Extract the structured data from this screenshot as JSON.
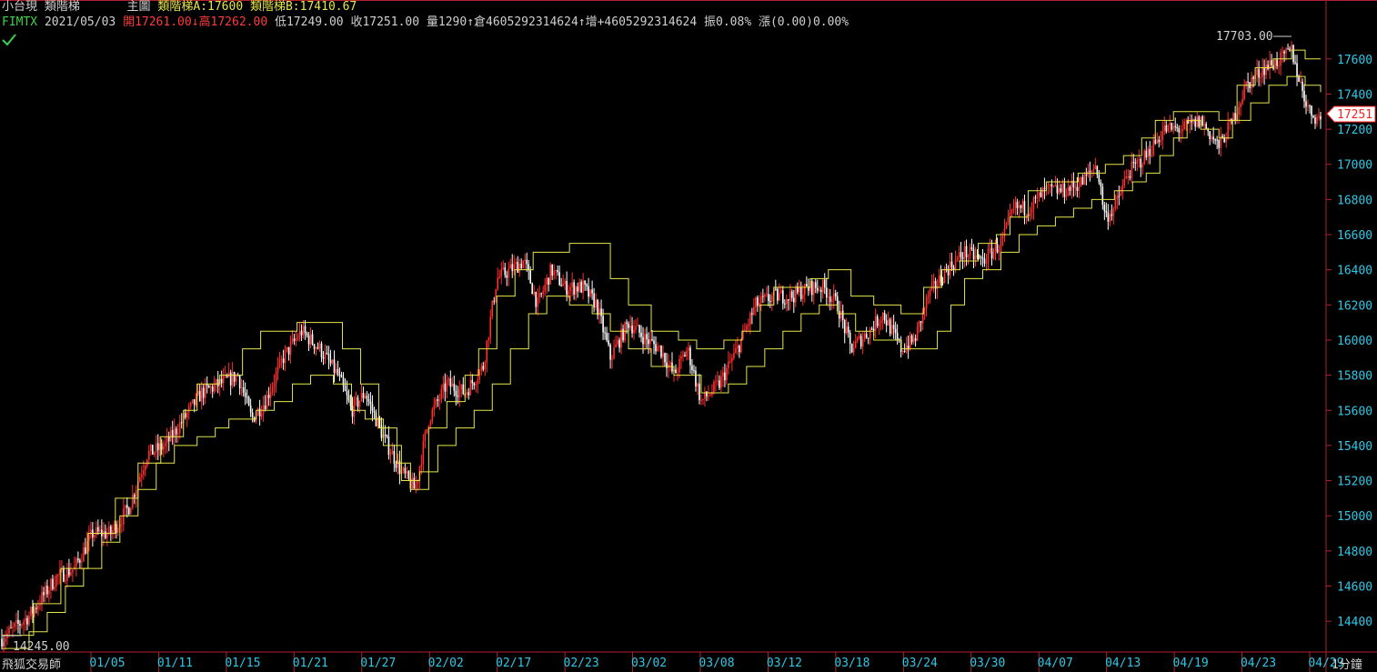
{
  "header": {
    "symbol_name": "小台現",
    "indicator_name": "類階梯",
    "pane_label": "主圖",
    "ladder_a_label": "類階梯A:17600",
    "ladder_b_label": "類階梯B:17410.67",
    "symbol_code": "FIMTX",
    "date": "2021/05/03",
    "open": "開17261.00",
    "high": "高17262.00",
    "low": "低17249.00",
    "close": "收17251.00",
    "volume": "量1290",
    "open_interest": "倉4605292314624",
    "oi_change": "增+4605292314624",
    "amplitude": "振0.08%",
    "change": "漲(0.00)0.00%",
    "up_arrow": "↑",
    "down_arrow": "↓"
  },
  "footer": {
    "app_name": "飛狐交易師",
    "interval": "1分鐘"
  },
  "colors": {
    "background": "#000000",
    "axis": "#b3202a",
    "price_tick": "#2ec8e6",
    "date_tick": "#2ec8e6",
    "candle_up": "#ff3030",
    "candle_down": "#ffffff",
    "ladder": "#e6e64a",
    "current_price_box": "#ff2020"
  },
  "chart_data": {
    "type": "candlestick",
    "y_ticks": [
      14400,
      14600,
      14800,
      15000,
      15200,
      15400,
      15600,
      15800,
      16000,
      16200,
      16400,
      16600,
      16800,
      17000,
      17200,
      17400,
      17600
    ],
    "ylim": [
      14230,
      17780
    ],
    "x_categories": [
      "01/05",
      "01/11",
      "01/15",
      "01/21",
      "01/27",
      "02/02",
      "02/17",
      "02/23",
      "03/02",
      "03/08",
      "03/12",
      "03/18",
      "03/24",
      "03/30",
      "04/07",
      "04/13",
      "04/19",
      "04/23",
      "04/29"
    ],
    "high_marker": "17703.00",
    "low_marker": "14245.00",
    "current_price": "17251",
    "close_series": [
      [
        0,
        14300
      ],
      [
        30,
        14430
      ],
      [
        60,
        14650
      ],
      [
        80,
        14700
      ],
      [
        100,
        14900
      ],
      [
        120,
        14900
      ],
      [
        140,
        15050
      ],
      [
        160,
        15350
      ],
      [
        180,
        15400
      ],
      [
        200,
        15550
      ],
      [
        220,
        15700
      ],
      [
        240,
        15750
      ],
      [
        260,
        15800
      ],
      [
        275,
        15550
      ],
      [
        290,
        15650
      ],
      [
        310,
        15900
      ],
      [
        330,
        16050
      ],
      [
        350,
        15950
      ],
      [
        370,
        15800
      ],
      [
        385,
        15600
      ],
      [
        400,
        15700
      ],
      [
        420,
        15450
      ],
      [
        440,
        15250
      ],
      [
        455,
        15150
      ],
      [
        470,
        15550
      ],
      [
        490,
        15750
      ],
      [
        510,
        15700
      ],
      [
        530,
        15850
      ],
      [
        545,
        16350
      ],
      [
        560,
        16400
      ],
      [
        575,
        16450
      ],
      [
        590,
        16200
      ],
      [
        605,
        16400
      ],
      [
        620,
        16300
      ],
      [
        640,
        16300
      ],
      [
        655,
        16200
      ],
      [
        670,
        15900
      ],
      [
        690,
        16100
      ],
      [
        710,
        16000
      ],
      [
        725,
        15950
      ],
      [
        740,
        15800
      ],
      [
        755,
        15950
      ],
      [
        770,
        15650
      ],
      [
        790,
        15750
      ],
      [
        810,
        15950
      ],
      [
        830,
        16200
      ],
      [
        850,
        16250
      ],
      [
        870,
        16250
      ],
      [
        890,
        16300
      ],
      [
        905,
        16300
      ],
      [
        920,
        16200
      ],
      [
        935,
        15950
      ],
      [
        955,
        16050
      ],
      [
        970,
        16150
      ],
      [
        990,
        15950
      ],
      [
        1005,
        16000
      ],
      [
        1020,
        16250
      ],
      [
        1040,
        16400
      ],
      [
        1060,
        16500
      ],
      [
        1080,
        16450
      ],
      [
        1100,
        16550
      ],
      [
        1115,
        16750
      ],
      [
        1130,
        16750
      ],
      [
        1150,
        16850
      ],
      [
        1170,
        16850
      ],
      [
        1190,
        16900
      ],
      [
        1205,
        17000
      ],
      [
        1215,
        16700
      ],
      [
        1225,
        16750
      ],
      [
        1240,
        16950
      ],
      [
        1260,
        17050
      ],
      [
        1280,
        17200
      ],
      [
        1300,
        17200
      ],
      [
        1320,
        17250
      ],
      [
        1340,
        17100
      ],
      [
        1355,
        17250
      ],
      [
        1370,
        17450
      ],
      [
        1390,
        17550
      ],
      [
        1410,
        17600
      ],
      [
        1420,
        17650
      ],
      [
        1430,
        17450
      ],
      [
        1440,
        17300
      ],
      [
        1452,
        17251
      ]
    ],
    "series": [
      {
        "name": "類階梯A",
        "steps": [
          [
            0,
            14320
          ],
          [
            35,
            14500
          ],
          [
            65,
            14700
          ],
          [
            95,
            14900
          ],
          [
            125,
            15100
          ],
          [
            150,
            15300
          ],
          [
            175,
            15450
          ],
          [
            200,
            15600
          ],
          [
            215,
            15750
          ],
          [
            240,
            15800
          ],
          [
            265,
            15950
          ],
          [
            285,
            16050
          ],
          [
            325,
            16100
          ],
          [
            345,
            16100
          ],
          [
            375,
            15950
          ],
          [
            395,
            15750
          ],
          [
            415,
            15500
          ],
          [
            435,
            15300
          ],
          [
            450,
            15150
          ],
          [
            470,
            15500
          ],
          [
            490,
            15650
          ],
          [
            510,
            15800
          ],
          [
            525,
            15950
          ],
          [
            545,
            16250
          ],
          [
            565,
            16400
          ],
          [
            585,
            16500
          ],
          [
            605,
            16500
          ],
          [
            625,
            16550
          ],
          [
            650,
            16550
          ],
          [
            670,
            16350
          ],
          [
            690,
            16200
          ],
          [
            715,
            16050
          ],
          [
            745,
            16000
          ],
          [
            765,
            15950
          ],
          [
            795,
            16000
          ],
          [
            815,
            16050
          ],
          [
            835,
            16200
          ],
          [
            850,
            16300
          ],
          [
            870,
            16300
          ],
          [
            890,
            16350
          ],
          [
            910,
            16400
          ],
          [
            935,
            16250
          ],
          [
            960,
            16200
          ],
          [
            990,
            16150
          ],
          [
            1015,
            16300
          ],
          [
            1035,
            16400
          ],
          [
            1055,
            16450
          ],
          [
            1075,
            16550
          ],
          [
            1095,
            16600
          ],
          [
            1110,
            16700
          ],
          [
            1130,
            16850
          ],
          [
            1150,
            16900
          ],
          [
            1185,
            16950
          ],
          [
            1215,
            17000
          ],
          [
            1235,
            17050
          ],
          [
            1255,
            17150
          ],
          [
            1270,
            17250
          ],
          [
            1290,
            17300
          ],
          [
            1320,
            17300
          ],
          [
            1340,
            17250
          ],
          [
            1360,
            17450
          ],
          [
            1380,
            17550
          ],
          [
            1400,
            17600
          ],
          [
            1420,
            17650
          ],
          [
            1435,
            17600
          ],
          [
            1452,
            17600
          ]
        ]
      },
      {
        "name": "類階梯B",
        "steps": [
          [
            0,
            14245
          ],
          [
            30,
            14340
          ],
          [
            50,
            14450
          ],
          [
            70,
            14600
          ],
          [
            90,
            14700
          ],
          [
            110,
            14850
          ],
          [
            130,
            15000
          ],
          [
            150,
            15150
          ],
          [
            170,
            15300
          ],
          [
            190,
            15400
          ],
          [
            215,
            15450
          ],
          [
            235,
            15500
          ],
          [
            250,
            15550
          ],
          [
            280,
            15600
          ],
          [
            300,
            15650
          ],
          [
            320,
            15750
          ],
          [
            340,
            15800
          ],
          [
            365,
            15750
          ],
          [
            385,
            15600
          ],
          [
            400,
            15550
          ],
          [
            420,
            15400
          ],
          [
            440,
            15200
          ],
          [
            460,
            15250
          ],
          [
            480,
            15400
          ],
          [
            500,
            15500
          ],
          [
            520,
            15600
          ],
          [
            540,
            15750
          ],
          [
            560,
            15950
          ],
          [
            580,
            16150
          ],
          [
            600,
            16250
          ],
          [
            625,
            16200
          ],
          [
            650,
            16150
          ],
          [
            670,
            16050
          ],
          [
            690,
            15950
          ],
          [
            715,
            15850
          ],
          [
            740,
            15800
          ],
          [
            770,
            15700
          ],
          [
            800,
            15750
          ],
          [
            820,
            15850
          ],
          [
            840,
            15950
          ],
          [
            860,
            16050
          ],
          [
            880,
            16150
          ],
          [
            900,
            16200
          ],
          [
            920,
            16150
          ],
          [
            940,
            16050
          ],
          [
            960,
            16000
          ],
          [
            990,
            15950
          ],
          [
            1010,
            15950
          ],
          [
            1030,
            16050
          ],
          [
            1045,
            16200
          ],
          [
            1060,
            16350
          ],
          [
            1080,
            16400
          ],
          [
            1100,
            16500
          ],
          [
            1120,
            16600
          ],
          [
            1140,
            16650
          ],
          [
            1160,
            16700
          ],
          [
            1180,
            16750
          ],
          [
            1200,
            16800
          ],
          [
            1225,
            16850
          ],
          [
            1245,
            16900
          ],
          [
            1260,
            16950
          ],
          [
            1275,
            17050
          ],
          [
            1290,
            17150
          ],
          [
            1305,
            17250
          ],
          [
            1320,
            17200
          ],
          [
            1340,
            17150
          ],
          [
            1355,
            17250
          ],
          [
            1375,
            17350
          ],
          [
            1395,
            17450
          ],
          [
            1415,
            17500
          ],
          [
            1435,
            17450
          ],
          [
            1452,
            17410.67
          ]
        ]
      }
    ]
  }
}
